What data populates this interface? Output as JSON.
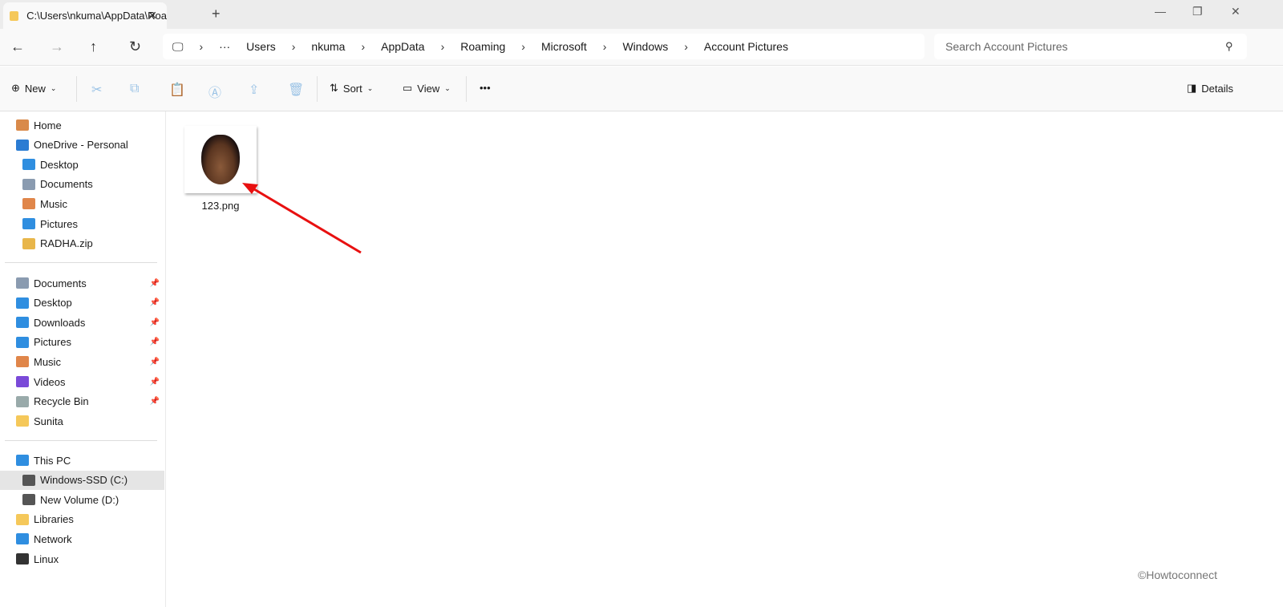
{
  "tab": {
    "title": "C:\\Users\\nkuma\\AppData\\Roa"
  },
  "breadcrumb": [
    "Users",
    "nkuma",
    "AppData",
    "Roaming",
    "Microsoft",
    "Windows",
    "Account Pictures"
  ],
  "search": {
    "placeholder": "Search Account Pictures"
  },
  "toolbar": {
    "new": "New",
    "sort": "Sort",
    "view": "View",
    "more": "•••",
    "details": "Details"
  },
  "sidebar": {
    "group1": [
      {
        "label": "Home",
        "color": "#d98a4a"
      },
      {
        "label": "OneDrive - Personal",
        "color": "#2b7cd3"
      },
      {
        "label": "Desktop",
        "color": "#2f8ee0",
        "indent": true
      },
      {
        "label": "Documents",
        "color": "#8a9bb0",
        "indent": true
      },
      {
        "label": "Music",
        "color": "#e0864a",
        "indent": true
      },
      {
        "label": "Pictures",
        "color": "#2f8ee0",
        "indent": true
      },
      {
        "label": "RADHA.zip",
        "color": "#e8b64a",
        "indent": true
      }
    ],
    "group2": [
      {
        "label": "Documents",
        "color": "#8a9bb0"
      },
      {
        "label": "Desktop",
        "color": "#2f8ee0"
      },
      {
        "label": "Downloads",
        "color": "#2f8ee0"
      },
      {
        "label": "Pictures",
        "color": "#2f8ee0"
      },
      {
        "label": "Music",
        "color": "#e0864a"
      },
      {
        "label": "Videos",
        "color": "#7a4ad8"
      },
      {
        "label": "Recycle Bin",
        "color": "#9aa"
      },
      {
        "label": "Sunita",
        "color": "#f5c85a"
      }
    ],
    "group3": [
      {
        "label": "This PC",
        "color": "#2f8ee0"
      },
      {
        "label": "Windows-SSD (C:)",
        "color": "#555",
        "indent": true,
        "selected": true
      },
      {
        "label": "New Volume (D:)",
        "color": "#555",
        "indent": true
      },
      {
        "label": "Libraries",
        "color": "#f5c85a"
      },
      {
        "label": "Network",
        "color": "#2f8ee0"
      },
      {
        "label": "Linux",
        "color": "#333"
      }
    ]
  },
  "files": [
    {
      "name": "123.png"
    }
  ],
  "watermark": "©Howtoconnect"
}
